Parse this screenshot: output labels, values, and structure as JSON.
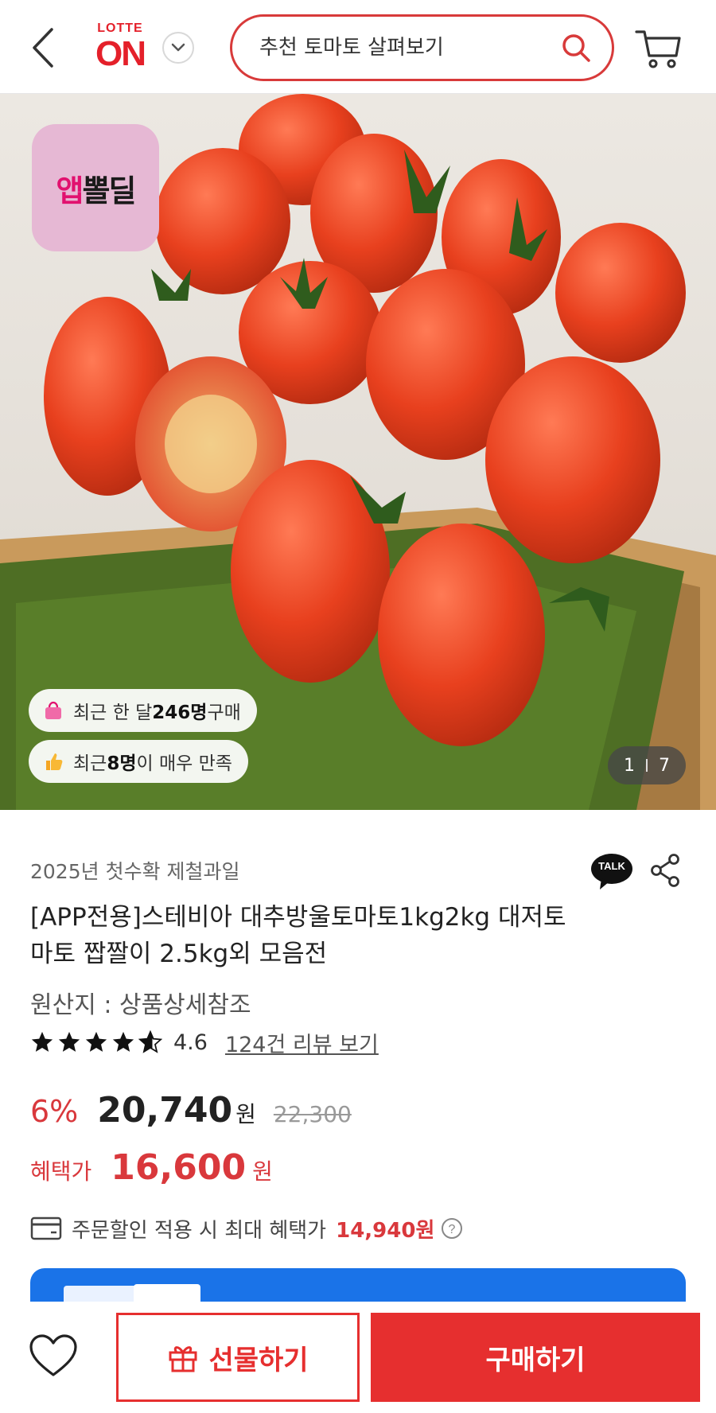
{
  "header": {
    "logo_top": "LOTTE",
    "logo_main": "ON",
    "search_placeholder": "추천 토마토 살펴보기",
    "icons": {
      "back": "chevron-left-icon",
      "dropdown": "chevron-down-icon",
      "search": "search-icon",
      "cart": "cart-icon"
    }
  },
  "hero": {
    "badge_part1": "앱",
    "badge_part2": "뽈딜",
    "pill1": {
      "prefix": "최근 한 달 ",
      "count": "246명",
      "suffix": " 구매"
    },
    "pill2": {
      "prefix": "최근 ",
      "count": "8명",
      "suffix": "이 매우 만족"
    },
    "counter_current": "1",
    "counter_total": "7"
  },
  "product": {
    "subtitle": "2025년 첫수확 제철과일",
    "title": "[APP전용]스테비아 대추방울토마토1kg2kg 대저토마토 짭짤이 2.5kg외 모음전",
    "origin": "원산지 : 상품상세참조",
    "rating": 4.6,
    "rating_text": "4.6",
    "review_link": "124건 리뷰 보기",
    "talk_label": "TALK"
  },
  "price": {
    "discount": "6%",
    "sale_price": "20,740",
    "won": "원",
    "original_price": "22,300",
    "benefit_label": "혜택가",
    "benefit_price": "16,600",
    "benefit_won": "원",
    "card_text": "주문할인 적용 시 최대 혜택가",
    "card_amount": "14,940원"
  },
  "bottom": {
    "gift_label": "선물하기",
    "buy_label": "구매하기"
  },
  "colors": {
    "brand_red": "#e62f2f",
    "price_red": "#d9383c",
    "banner_blue": "#1a73e8"
  }
}
